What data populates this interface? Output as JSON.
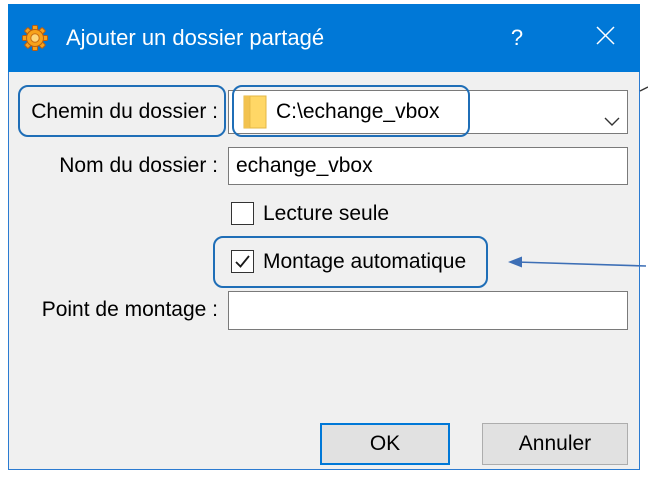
{
  "window": {
    "title": "Ajouter un dossier partagé",
    "help_label": "?",
    "app_icon": "virtualbox-icon",
    "close_icon": "close-icon"
  },
  "form": {
    "path": {
      "label": "Chemin du dossier :",
      "value": "C:\\echange_vbox",
      "icon": "folder-icon",
      "dropdown_icon": "chevron-down-icon"
    },
    "name": {
      "label": "Nom du dossier :",
      "value": "echange_vbox"
    },
    "read_only": {
      "label": "Lecture seule",
      "checked": false
    },
    "auto_mount": {
      "label": "Montage automatique",
      "checked": true
    },
    "mount_point": {
      "label": "Point de montage :",
      "value": ""
    }
  },
  "buttons": {
    "ok": "OK",
    "cancel": "Annuler"
  },
  "colors": {
    "title_bar": "#0078D7",
    "content": "#F0F0F0",
    "highlight": "#1F6EB7",
    "default_button_border": "#0078D7",
    "annotation_arrow": "#3D6FB6"
  }
}
